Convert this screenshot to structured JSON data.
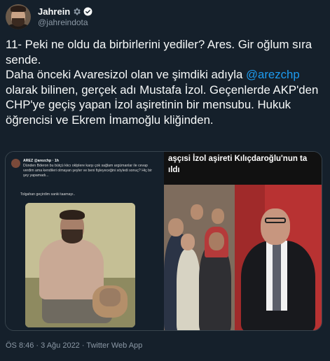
{
  "tweet": {
    "display_name": "Jahrein",
    "handle": "@jahreindota",
    "text_part1": "11- Peki ne oldu da birbirlerini yediler? Ares. Gir oğlum sıra sende.\nDaha önceki Avaresizol olan ve şimdiki adıyla ",
    "mention": "@arezchp",
    "text_part2": " olarak bilinen, gerçek adı Mustafa İzol. Geçenlerde AKP'den CHP'ye geçiş yapan İzol aşiretinin bir mensubu. Hukuk öğrencisi ve Ekrem İmamoğlu kliğinden.",
    "meta": "ÖS 8:46 · 3 Ağu 2022 · Twitter Web App"
  },
  "media_left": {
    "embedded_user": "AREZ @arezchp · 1h",
    "embedded_text": "Dünden Bderon bu bütçü kkcı oklplere karşı çok sağlam argümanlar ile cevap verdim ama kendileri olmayan şeyler ve beni fişleyeceğini söyledi sonuç? Hiç bir şey yapamadı...",
    "embedded_text2": "Tolgahan geçirdim sanki taamayı.."
  },
  "media_right": {
    "headline": "aşçısi İzol aşireti Kılıçdaroğlu'nun ta\nıldı"
  },
  "colors": {
    "background": "#15202b",
    "text": "#f7f9f9",
    "secondary": "#8b98a5",
    "accent": "#1d9bf0"
  },
  "icons": {
    "gear": "gear-icon",
    "verified": "verified-badge-icon"
  }
}
